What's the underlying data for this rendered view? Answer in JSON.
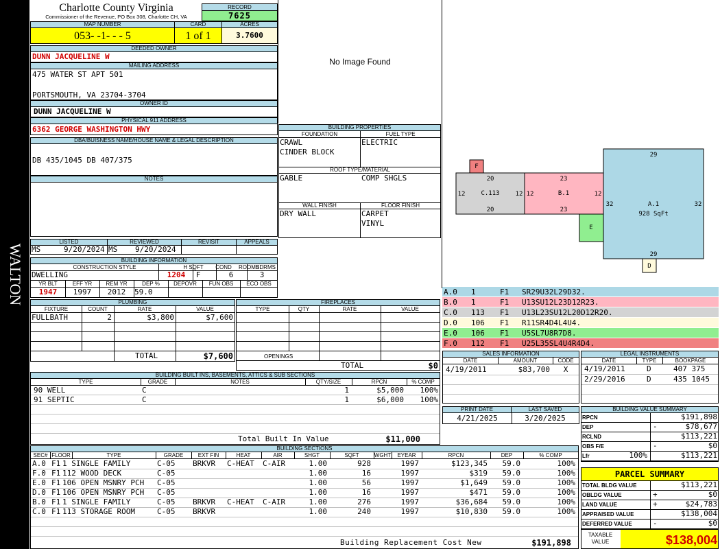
{
  "county": {
    "name": "Charlotte County Virginia",
    "office": "Commissioner of the Revenue, PO Box 308, Charlotte CH, VA"
  },
  "district": "WALTON",
  "record": {
    "label": "RECORD",
    "value": "7625"
  },
  "map_number": {
    "label": "MAP NUMBER",
    "value": "053- -1- - - 5"
  },
  "card": {
    "label": "CARD",
    "value": "1 of 1"
  },
  "acres": {
    "label": "ACRES",
    "value": "3.7600"
  },
  "deeded_owner": {
    "label": "DEEDED OWNER",
    "value": "DUNN JACQUELINE W"
  },
  "mailing": {
    "label": "MAILING ADDRESS",
    "line1": "475 WATER ST APT 501",
    "line2": "PORTSMOUTH, VA 23704-3704"
  },
  "owner_id": {
    "label": "OWNER ID",
    "value": "DUNN JACQUELINE W"
  },
  "physical": {
    "label": "PHYSICAL 911 ADDRESS",
    "value": "6362 GEORGE WASHINGTON HWY"
  },
  "dba": {
    "label": "DBA/BUISNESS NAME/HOUSE NAME & LEGAL DESCRIPTION",
    "value": "DB 435/1045 DB 407/375"
  },
  "notes": {
    "label": "NOTES"
  },
  "image": {
    "text": "No Image Found"
  },
  "building_props": {
    "label": "BUILDING PROPERTIES",
    "foundation_label": "FOUNDATION",
    "fuel_label": "FUEL TYPE",
    "foundation1": "CRAWL",
    "foundation2": "CINDER BLOCK",
    "fuel": "ELECTRIC",
    "roof_label": "ROOF TYPE/MATERIAL",
    "roof_type": "GABLE",
    "roof_material": "COMP SHGLS",
    "wall_label": "WALL FINISH",
    "floor_label": "FLOOR FINISH",
    "wall": "DRY WALL",
    "floor1": "CARPET",
    "floor2": "VINYL"
  },
  "listed": {
    "label": "LISTED",
    "by": "MS",
    "date": "9/20/2024"
  },
  "reviewed": {
    "label": "REVIEWED",
    "by": "MS",
    "date": "9/20/2024"
  },
  "revisit": {
    "label": "REVISIT"
  },
  "appeals": {
    "label": "APPEALS"
  },
  "bldg_info": {
    "label": "BUILDING INFORMATION",
    "cs_label": "CONSTRUCTION STYLE",
    "hsqft_label": "H SQFT",
    "cond_label": "COND",
    "rooms_label": "ROOMS",
    "bdrms_label": "BDRMS",
    "style": "DWELLING",
    "hsqft": "1204",
    "cond": "F",
    "rooms": "6",
    "bdrms": "3",
    "yrblt_label": "YR BLT",
    "effyr_label": "EFF YR",
    "remyr_label": "REM YR",
    "dep_label": "DEP %",
    "depovr_label": "DEPOVR",
    "funobs_label": "FUN OBS",
    "ecoobs_label": "ECO OBS",
    "yrblt": "1947",
    "effyr": "1997",
    "remyr": "2012",
    "dep": "59.0"
  },
  "plumbing": {
    "label": "PLUMBING",
    "h_fixture": "FIXTURE",
    "h_count": "COUNT",
    "h_rate": "RATE",
    "h_value": "VALUE",
    "fixture": "FULLBATH",
    "count": "2",
    "rate": "$3,800",
    "value": "$7,600",
    "total_label": "TOTAL",
    "total": "$7,600"
  },
  "fireplaces": {
    "label": "FIREPLACES",
    "h_type": "TYPE",
    "h_qty": "QTY",
    "h_rate": "RATE",
    "h_value": "VALUE",
    "openings": "OPENINGS",
    "total_label": "TOTAL",
    "total": "$0"
  },
  "builtins": {
    "label": "BUILDING BUILT INS, BASEMENTS, ATTICS & SUB SECTIONS",
    "h_type": "TYPE",
    "h_grade": "GRADE",
    "h_notes": "NOTES",
    "h_qty": "QTY/SIZE",
    "h_rpcn": "RPCN",
    "h_comp": "% COMP",
    "rows": [
      {
        "type": "90 WELL",
        "grade": "C",
        "qty": "1",
        "rpcn": "$5,000",
        "comp": "100%"
      },
      {
        "type": "91 SEPTIC",
        "grade": "C",
        "qty": "1",
        "rpcn": "$6,000",
        "comp": "100%"
      }
    ],
    "total_label": "Total Built In Value",
    "total": "$11,000"
  },
  "sections": {
    "label": "BUILDING SECTIONS",
    "headers": [
      "SEC#",
      "FLOOR",
      "TYPE",
      "GRADE",
      "EXT FIN",
      "HEAT",
      "AIR",
      "SHGT",
      "SQFT",
      "WGHT",
      "EYEAR",
      "RPCN",
      "DEP",
      "% COMP"
    ],
    "rows": [
      [
        "A.0",
        "F1",
        "1 SINGLE FAMILY",
        "C-05",
        "BRKVR",
        "C-HEAT",
        "C-AIR",
        "1.00",
        "928",
        "",
        "1997",
        "$123,345",
        "59.0",
        "100%"
      ],
      [
        "F.0",
        "F1",
        "112 WOOD DECK",
        "C-05",
        "",
        "",
        "",
        "1.00",
        "16",
        "",
        "1997",
        "$319",
        "59.0",
        "100%"
      ],
      [
        "E.0",
        "F1",
        "106 OPEN MSNRY PCH",
        "C-05",
        "",
        "",
        "",
        "1.00",
        "56",
        "",
        "1997",
        "$1,649",
        "59.0",
        "100%"
      ],
      [
        "D.0",
        "F1",
        "106 OPEN MSNRY PCH",
        "C-05",
        "",
        "",
        "",
        "1.00",
        "16",
        "",
        "1997",
        "$471",
        "59.0",
        "100%"
      ],
      [
        "B.0",
        "F1",
        "1 SINGLE FAMILY",
        "C-05",
        "BRKVR",
        "C-HEAT",
        "C-AIR",
        "1.00",
        "276",
        "",
        "1997",
        "$36,684",
        "59.0",
        "100%"
      ],
      [
        "C.0",
        "F1",
        "113 STORAGE ROOM",
        "C-05",
        "BRKVR",
        "",
        "",
        "1.00",
        "240",
        "",
        "1997",
        "$10,830",
        "59.0",
        "100%"
      ]
    ],
    "total_label": "Building Replacement Cost New",
    "total": "$191,898"
  },
  "sketch": {
    "a_label": "A.1",
    "a_sqft": "928 SqFt",
    "a_top": "29",
    "a_bottom": "29",
    "a_left": "32",
    "a_right": "32",
    "b_label": "B.1",
    "b_top": "23",
    "b_bottom": "23",
    "b_left": "12",
    "b_right": "12",
    "c_label": "C.113",
    "c_top": "20",
    "c_bottom": "20",
    "c_left": "12",
    "c_right": "12",
    "f_label": "F",
    "e_label": "E",
    "d_label": "D"
  },
  "sketch_legend": [
    {
      "sec": "A.0",
      "code": "1",
      "fl": "F1",
      "desc": "SR29U32L29D32.",
      "color": "#add8e6"
    },
    {
      "sec": "B.0",
      "code": "1",
      "fl": "F1",
      "desc": "U13SU12L23D12R23.",
      "color": "#ffb6c1"
    },
    {
      "sec": "C.0",
      "code": "113",
      "fl": "F1",
      "desc": "U13L23SU12L20D12R20.",
      "color": "#d3d3d3"
    },
    {
      "sec": "D.0",
      "code": "106",
      "fl": "F1",
      "desc": "R11SR4D4L4U4.",
      "color": "#fffadc"
    },
    {
      "sec": "E.0",
      "code": "106",
      "fl": "F1",
      "desc": "U5SL7U8R7D8.",
      "color": "#90ee90"
    },
    {
      "sec": "F.0",
      "code": "112",
      "fl": "F1",
      "desc": "U25L35SL4U4R4D4.",
      "color": "#f08080"
    }
  ],
  "sales": {
    "label": "SALES INFORMATION",
    "h_date": "DATE",
    "h_amount": "AMOUNT",
    "h_code": "CODE",
    "date": "4/19/2011",
    "amount": "$83,700",
    "code": "X"
  },
  "legal": {
    "label": "LEGAL INSTRUMENTS",
    "h_date": "DATE",
    "h_type": "TYPE",
    "h_book": "BOOKPAGE",
    "rows": [
      {
        "date": "4/19/2011",
        "type": "D",
        "book": "407 375"
      },
      {
        "date": "2/29/2016",
        "type": "D",
        "book": "435 1045"
      }
    ]
  },
  "print": {
    "print_label": "PRINT DATE",
    "saved_label": "LAST SAVED",
    "print_date": "4/21/2025",
    "saved_date": "3/20/2025"
  },
  "bvs": {
    "label": "BUILDING VALUE SUMMARY",
    "rows": [
      {
        "k": "RPCN",
        "s": "",
        "v": "$191,898"
      },
      {
        "k": "DEP",
        "s": "-",
        "v": "$78,677"
      },
      {
        "k": "RCLND",
        "s": "",
        "v": "$113,221"
      },
      {
        "k": "OBS F/E",
        "s": "-",
        "v": "$0"
      },
      {
        "k": "Lfr",
        "pct": "100%",
        "s": "",
        "v": "$113,221"
      }
    ]
  },
  "parcel": {
    "label": "PARCEL SUMMARY",
    "rows": [
      {
        "k": "TOTAL BLDG VALUE",
        "s": "",
        "v": "$113,221"
      },
      {
        "k": "OBLDG VALUE",
        "s": "+",
        "v": "$0"
      },
      {
        "k": "LAND VALUE",
        "s": "+",
        "v": "$24,783"
      },
      {
        "k": "APPRAISED VALUE",
        "s": "",
        "v": "$138,004"
      },
      {
        "k": "DEFERRED VALUE",
        "s": "-",
        "v": "$0"
      }
    ],
    "taxable_label1": "TAXABLE",
    "taxable_label2": "VALUE",
    "taxable": "$138,004"
  }
}
